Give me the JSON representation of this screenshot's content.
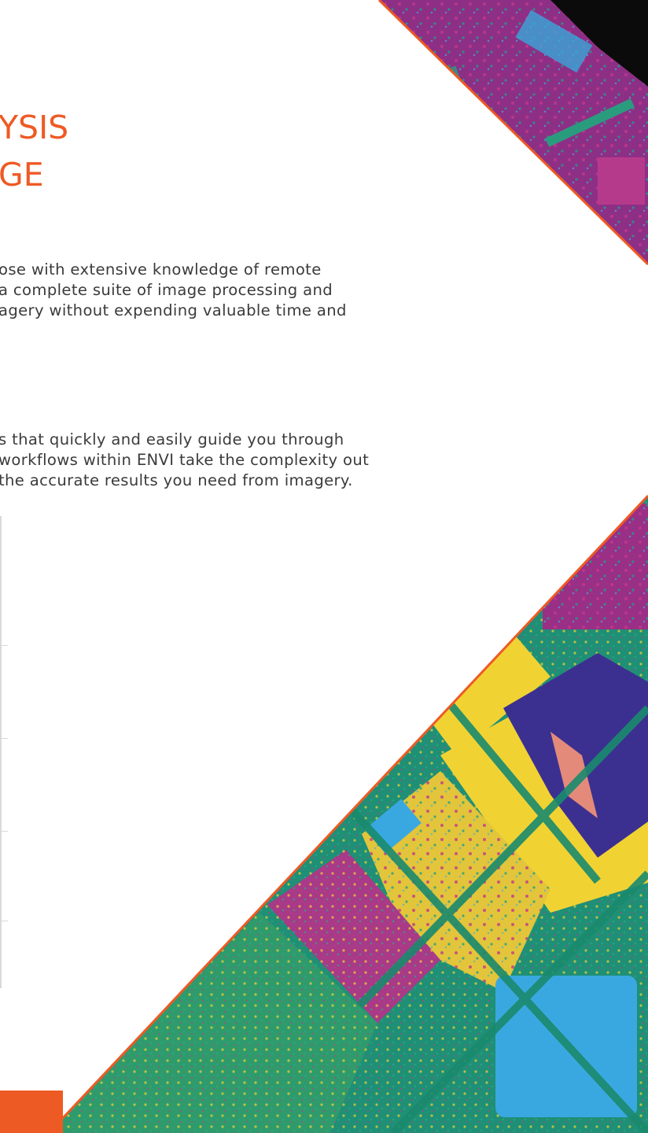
{
  "heading": {
    "line1": "YSIS",
    "line2": "GE"
  },
  "paragraph1": [
    "ose with extensive knowledge of remote",
    "a complete suite of image processing and",
    "agery without expending valuable time and"
  ],
  "paragraph2": [
    "s that quickly and easily guide you through",
    "workflows within ENVI take the complexity out",
    "the accurate results you need from imagery."
  ],
  "colors": {
    "accent": "#ee5a24",
    "body_text": "#3b3b3b",
    "rule": "#d9d9d9"
  }
}
